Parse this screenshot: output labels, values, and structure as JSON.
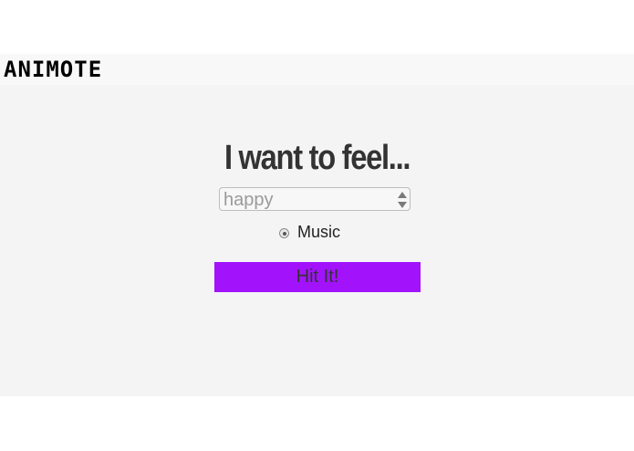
{
  "brand": {
    "logo_text": "ANIMOTE"
  },
  "form": {
    "headline": "I want to feel...",
    "feeling_select": {
      "value": "happy"
    },
    "option": {
      "label": "Music",
      "selected": true
    },
    "submit_label": "Hit It!"
  },
  "colors": {
    "button": "#a213fb",
    "panel_background": "#f4f4f4",
    "topbar_background": "#f8f8f8"
  },
  "icons": {
    "select_arrows": "up-down-arrows-icon",
    "radio": "radio-selected"
  }
}
